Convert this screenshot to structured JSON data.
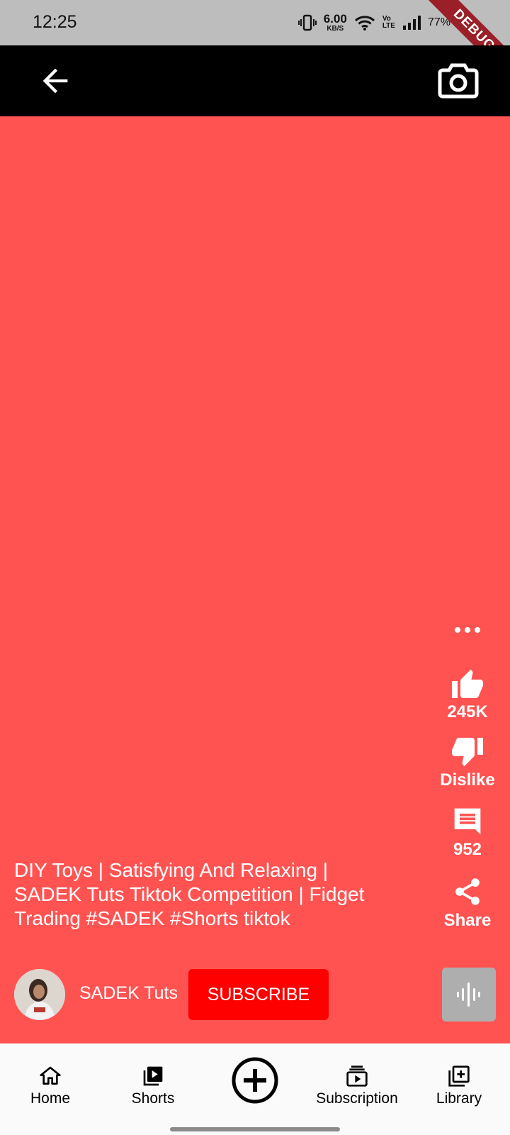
{
  "status_bar": {
    "time": "12:25",
    "net_speed_value": "6.00",
    "net_speed_unit": "KB/S",
    "volte_top": "Vo",
    "volte_bottom": "LTE",
    "battery": "77%",
    "debug_banner": "DEBUG"
  },
  "app_bar": {
    "back_icon": "arrow-left-icon",
    "camera_icon": "camera-icon"
  },
  "actions": {
    "more_icon": "more-horizontal-icon",
    "like_count": "245K",
    "dislike_label": "Dislike",
    "comment_count": "952",
    "share_label": "Share"
  },
  "video": {
    "caption": "DIY Toys | Satisfying And Relaxing | SADEK Tuts Tiktok Competition | Fidget Trading #SADEK #Shorts tiktok",
    "background_color": "#ff5352"
  },
  "channel": {
    "name": "SADEK Tuts",
    "subscribe_label": "SUBSCRIBE",
    "subscribe_color": "#ff0000"
  },
  "bottom_nav": {
    "items": [
      {
        "label": "Home",
        "icon": "home-icon"
      },
      {
        "label": "Shorts",
        "icon": "shorts-icon"
      },
      {
        "label": "",
        "icon": "add-circle-icon"
      },
      {
        "label": "Subscription",
        "icon": "subscriptions-icon"
      },
      {
        "label": "Library",
        "icon": "library-icon"
      }
    ]
  }
}
